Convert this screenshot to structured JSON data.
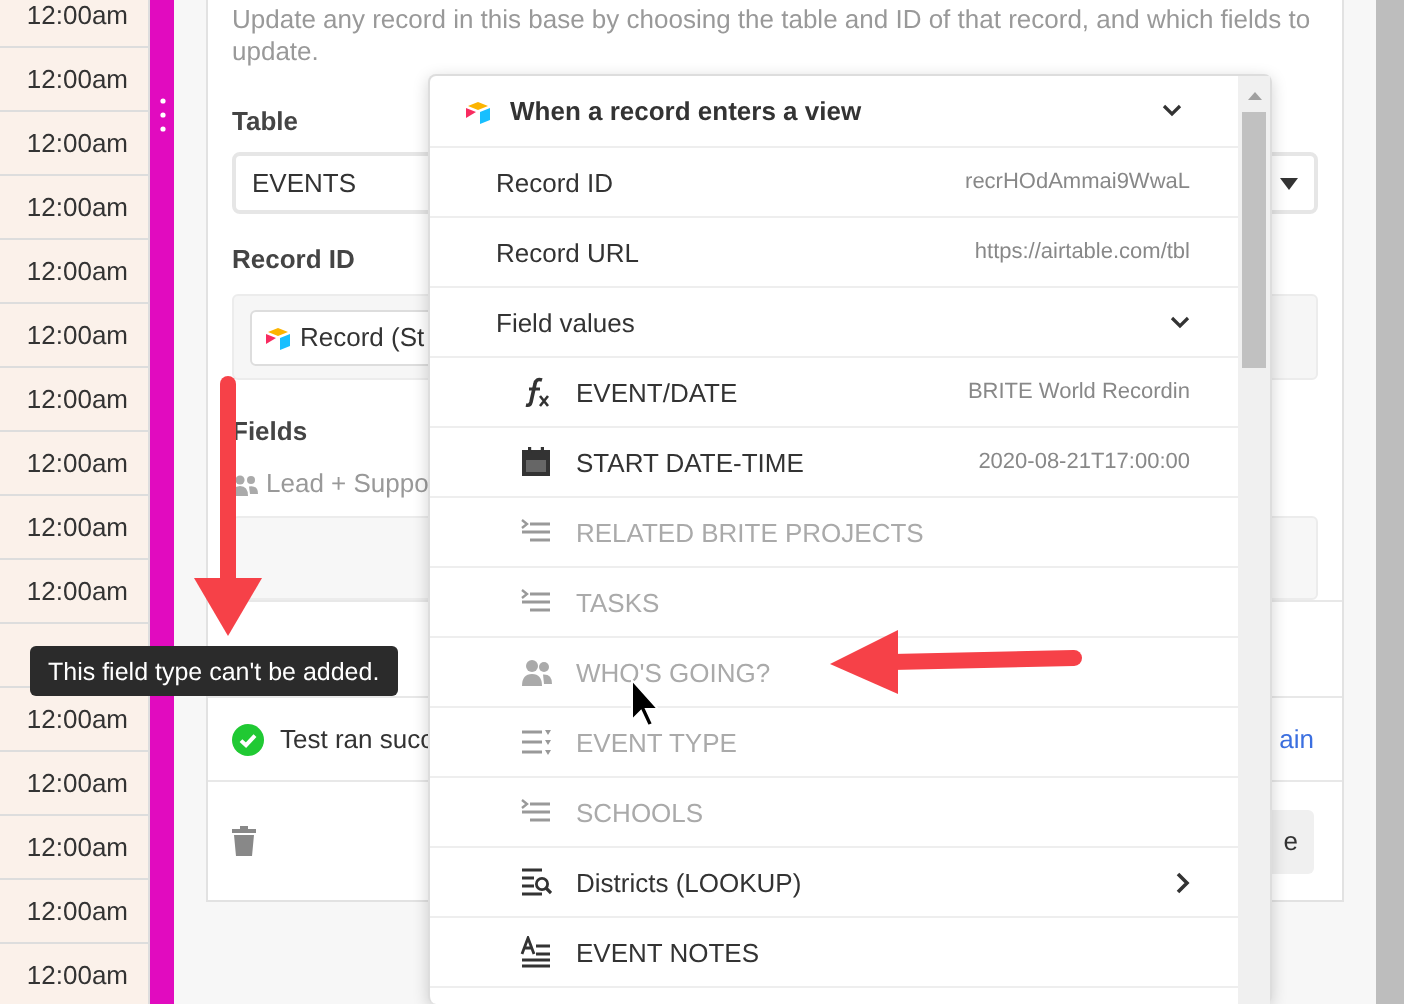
{
  "calendar": {
    "time_groups": [
      [
        "12:00am",
        "12:00am",
        "12:00am",
        "12:00am",
        "12:00am",
        "12:00am",
        "12:00am",
        "12:00am",
        "12:00am",
        "12:00am"
      ],
      [
        "12:00am",
        "12:00am",
        "12:00am",
        "12:00am",
        "12:00am"
      ]
    ]
  },
  "form": {
    "description": "Update any record in this base by choosing the table and ID of that record, and which fields to update.",
    "table_label": "Table",
    "table_value": "EVENTS",
    "record_id_label": "Record ID",
    "record_token": "Record (St",
    "fields_label": "Fields",
    "field_token": "Lead + Suppo",
    "test_status": "Test ran succ",
    "test_again": "ain",
    "action_button": "e"
  },
  "tooltip": "This field type can't be added.",
  "dropdown": {
    "title": "When a record enters a view",
    "items": [
      {
        "label": "Record ID",
        "value": "recrHOdAmmai9WwaL"
      },
      {
        "label": "Record URL",
        "value": "https://airtable.com/tbl"
      },
      {
        "label": "Field values",
        "expanded": true,
        "children": [
          {
            "label": "EVENT/DATE",
            "value": "BRITE World Recordin",
            "kind": "formula",
            "disabled": false,
            "submenu": false
          },
          {
            "label": "START DATE-TIME",
            "value": "2020-08-21T17:00:00",
            "kind": "date",
            "disabled": false,
            "submenu": false
          },
          {
            "label": "RELATED BRITE PROJECTS",
            "kind": "link",
            "disabled": true,
            "submenu": false
          },
          {
            "label": "TASKS",
            "kind": "link",
            "disabled": true,
            "submenu": false
          },
          {
            "label": "WHO'S GOING?",
            "kind": "people",
            "disabled": true,
            "submenu": false
          },
          {
            "label": "EVENT TYPE",
            "kind": "select",
            "disabled": true,
            "submenu": false
          },
          {
            "label": "SCHOOLS",
            "kind": "link",
            "disabled": true,
            "submenu": false
          },
          {
            "label": "Districts (LOOKUP)",
            "kind": "lookup",
            "disabled": false,
            "submenu": true
          },
          {
            "label": "EVENT NOTES",
            "kind": "longtext",
            "disabled": false,
            "submenu": false
          }
        ]
      }
    ]
  }
}
